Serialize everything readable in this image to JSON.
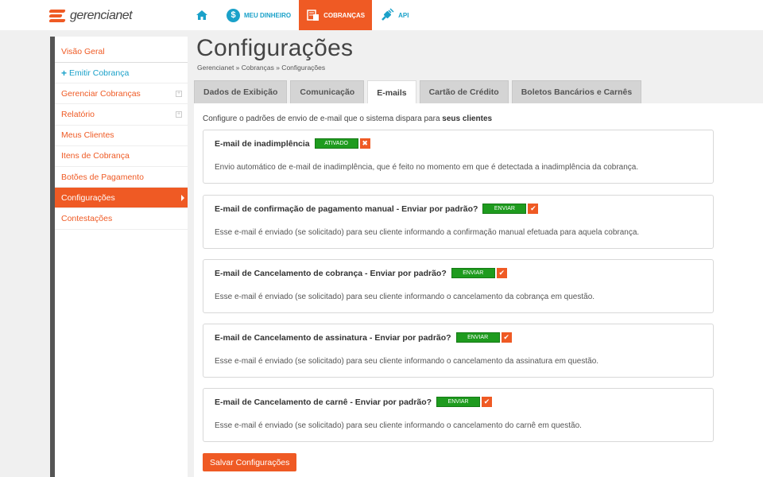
{
  "brand": {
    "name": "gerencianet",
    "accent": "#ef5a24",
    "link": "#1aa1c9"
  },
  "nav": {
    "items": [
      {
        "label": "",
        "icon": "home-icon"
      },
      {
        "label": "MEU DINHEIRO",
        "icon": "coin-icon"
      },
      {
        "label": "COBRANÇAS",
        "icon": "invoice-icon"
      },
      {
        "label": "API",
        "icon": "plug-icon"
      }
    ]
  },
  "sidebar": {
    "items": [
      {
        "label": "Visão Geral"
      },
      {
        "label": "Emitir Cobrança",
        "prefix": "+"
      },
      {
        "label": "Gerenciar Cobranças"
      },
      {
        "label": "Relatório"
      },
      {
        "label": "Meus Clientes"
      },
      {
        "label": "Itens de Cobrança"
      },
      {
        "label": "Botões de Pagamento"
      },
      {
        "label": "Configurações"
      },
      {
        "label": "Contestações"
      }
    ]
  },
  "page": {
    "title": "Configurações",
    "breadcrumb": "Gerencianet » Cobranças » Configurações"
  },
  "tabs": [
    {
      "label": "Dados de Exibição"
    },
    {
      "label": "Comunicação"
    },
    {
      "label": "E-mails"
    },
    {
      "label": "Cartão de Crédito"
    },
    {
      "label": "Boletos Bancários e Carnês"
    }
  ],
  "intro": {
    "text": "Configure o padrões de envio de e-mail que o sistema dispara para ",
    "bold": "seus clientes"
  },
  "cards": [
    {
      "title": "E-mail de inadimplência",
      "toggle": "ATIVADO",
      "action": "✖",
      "desc": "Envio automático de e-mail de inadimplência, que é feito no momento em que é detectada a inadimplência da cobrança."
    },
    {
      "title": "E-mail de confirmação de pagamento manual - Enviar por padrão?",
      "toggle": "ENVIAR",
      "action": "✔",
      "desc": "Esse e-mail é enviado (se solicitado) para seu cliente informando a confirmação manual efetuada para aquela cobrança."
    },
    {
      "title": "E-mail de Cancelamento de cobrança - Enviar por padrão?",
      "toggle": "ENVIAR",
      "action": "✔",
      "desc": "Esse e-mail é enviado (se solicitado) para seu cliente informando o cancelamento da cobrança em questão."
    },
    {
      "title": "E-mail de Cancelamento de assinatura - Enviar por padrão?",
      "toggle": "ENVIAR",
      "action": "✔",
      "desc": "Esse e-mail é enviado (se solicitado) para seu cliente informando o cancelamento da assinatura em questão."
    },
    {
      "title": "E-mail de Cancelamento de carnê - Enviar por padrão?",
      "toggle": "ENVIAR",
      "action": "✔",
      "desc": "Esse e-mail é enviado (se solicitado) para seu cliente informando o cancelamento do carnê em questão."
    }
  ],
  "save_label": "Salvar Configurações"
}
